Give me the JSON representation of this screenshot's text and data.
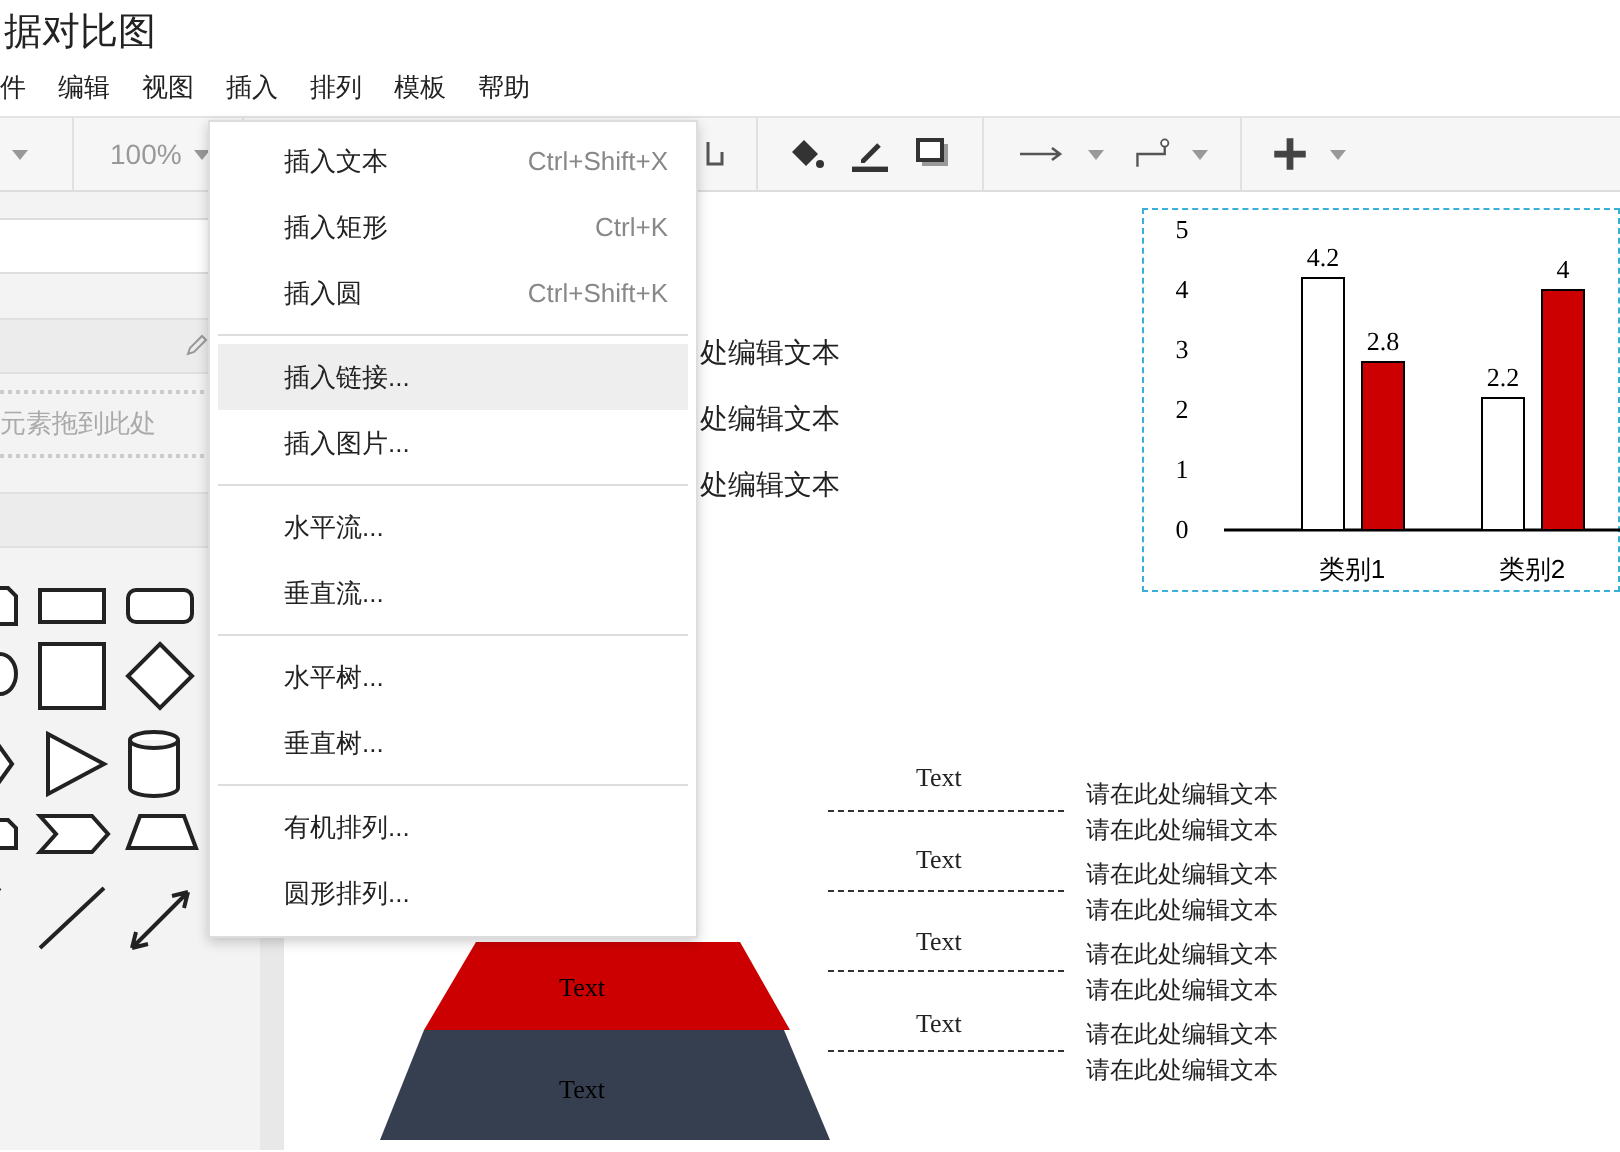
{
  "title": "据对比图",
  "menu": [
    "件",
    "编辑",
    "视图",
    "插入",
    "排列",
    "模板",
    "帮助"
  ],
  "toolbar": {
    "zoom": "100%"
  },
  "sidebar": {
    "drop_hint": "元素拖到此处"
  },
  "insert_menu": [
    [
      {
        "label": "插入文本",
        "shortcut": "Ctrl+Shift+X",
        "selected": false
      },
      {
        "label": "插入矩形",
        "shortcut": "Ctrl+K",
        "selected": false
      },
      {
        "label": "插入圆",
        "shortcut": "Ctrl+Shift+K",
        "selected": false
      }
    ],
    [
      {
        "label": "插入链接...",
        "selected": true
      },
      {
        "label": "插入图片...",
        "selected": false
      }
    ],
    [
      {
        "label": "水平流...",
        "selected": false
      },
      {
        "label": "垂直流...",
        "selected": false
      }
    ],
    [
      {
        "label": "水平树...",
        "selected": false
      },
      {
        "label": "垂直树...",
        "selected": false
      }
    ],
    [
      {
        "label": "有机排列...",
        "selected": false
      },
      {
        "label": "圆形排列...",
        "selected": false
      }
    ]
  ],
  "canvas": {
    "texts": [
      "处编辑文本",
      "处编辑文本",
      "处编辑文本"
    ],
    "chart_data": {
      "type": "bar",
      "categories": [
        "类别1",
        "类别2"
      ],
      "series": [
        {
          "color": "#ffffff",
          "values": [
            4.2,
            2.2
          ]
        },
        {
          "color": "#cc0000",
          "values": [
            2.8,
            4
          ]
        }
      ],
      "ylim": [
        0,
        5
      ],
      "yticks": [
        0,
        1,
        2,
        3,
        4,
        5
      ],
      "data_labels": true
    },
    "pyramid": [
      {
        "label": "Text",
        "color": "#cc0000"
      },
      {
        "label": "Text",
        "color": "#353f50"
      }
    ],
    "labels": [
      {
        "title": "Text",
        "lines": [
          "请在此处编辑文本",
          "请在此处编辑文本"
        ]
      },
      {
        "title": "Text",
        "lines": [
          "请在此处编辑文本",
          "请在此处编辑文本"
        ]
      },
      {
        "title": "Text",
        "lines": [
          "请在此处编辑文本",
          "请在此处编辑文本"
        ]
      },
      {
        "title": "Text",
        "lines": [
          "请在此处编辑文本",
          "请在此处编辑文本"
        ]
      }
    ]
  }
}
